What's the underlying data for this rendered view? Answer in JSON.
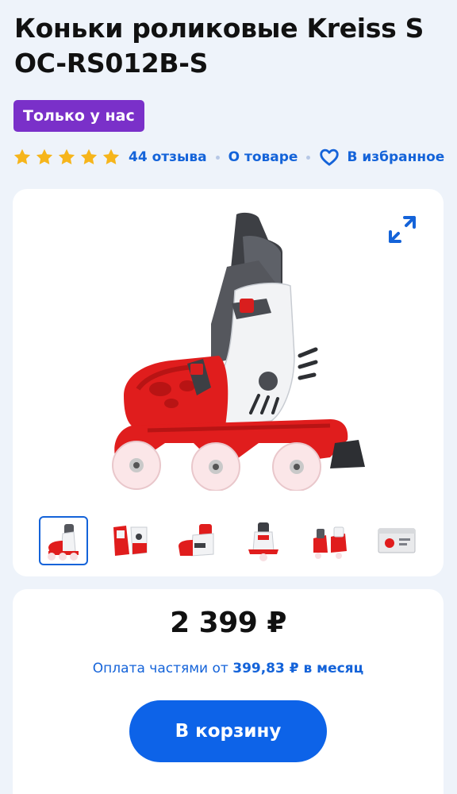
{
  "product": {
    "title": "Коньки роликовые Kreiss S OC-RS012B-S",
    "badge": "Только у нас"
  },
  "rating": {
    "stars_filled": 5,
    "stars_total": 5,
    "star_color": "#f6b51b",
    "reviews_label": "44 отзыва"
  },
  "links": {
    "about": "О товаре",
    "favorite": "В избранное"
  },
  "gallery": {
    "main_image_icon": "inline-skate-image",
    "expand_icon": "expand-icon",
    "thumbnails": [
      {
        "name": "thumb-skate-side",
        "active": true
      },
      {
        "name": "thumb-skate-front",
        "active": false
      },
      {
        "name": "thumb-skate-detail",
        "active": false
      },
      {
        "name": "thumb-skate-back",
        "active": false
      },
      {
        "name": "thumb-skate-pair",
        "active": false
      },
      {
        "name": "thumb-skate-box",
        "active": false
      }
    ]
  },
  "purchase": {
    "price": "2 399 ₽",
    "installment_prefix": "Оплата частями от ",
    "installment_amount": "399,83 ₽ в месяц",
    "cart_button": "В корзину"
  },
  "colors": {
    "accent_blue": "#1463d9",
    "badge_purple": "#7a30c9",
    "skate_red": "#e01d1d"
  }
}
